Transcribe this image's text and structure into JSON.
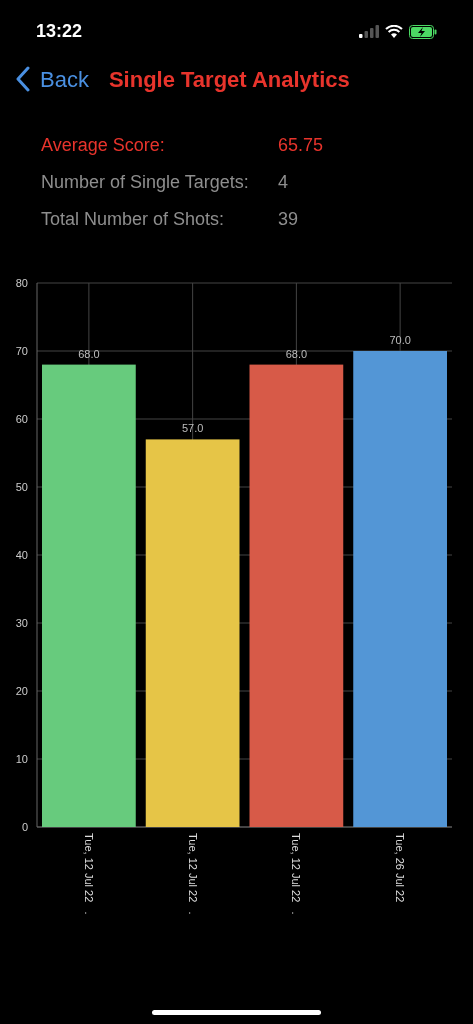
{
  "status_bar": {
    "time": "13:22"
  },
  "nav": {
    "back": "Back",
    "title": "Single Target Analytics"
  },
  "stats": [
    {
      "label": "Average Score:",
      "value": "65.75",
      "highlight": true
    },
    {
      "label": "Number of Single Targets:",
      "value": "4",
      "highlight": false
    },
    {
      "label": "Total Number of Shots:",
      "value": "39",
      "highlight": false
    }
  ],
  "chart": {
    "chart_data": {
      "type": "bar",
      "categories": [
        "Tue, 12 Jul 22   .",
        "Tue, 12 Jul 22   .",
        "Tue, 12 Jul 22   .",
        "Tue, 26 Jul 22"
      ],
      "series": [
        {
          "color": "#67cb7d",
          "values": [
            68.0,
            null,
            null,
            null
          ]
        },
        {
          "color": "#e6c547",
          "values": [
            null,
            57.0,
            null,
            null
          ]
        },
        {
          "color": "#d75a48",
          "values": [
            null,
            null,
            68.0,
            null
          ]
        },
        {
          "color": "#5396d6",
          "values": [
            null,
            null,
            null,
            70.0
          ]
        }
      ],
      "stacked": true,
      "grid": true,
      "ylim": [
        0,
        80
      ],
      "yticks": [
        0,
        10,
        20,
        30,
        40,
        50,
        60,
        70,
        80
      ],
      "value_labels": [
        "68.0",
        "57.0",
        "68.0",
        "70.0"
      ]
    }
  }
}
